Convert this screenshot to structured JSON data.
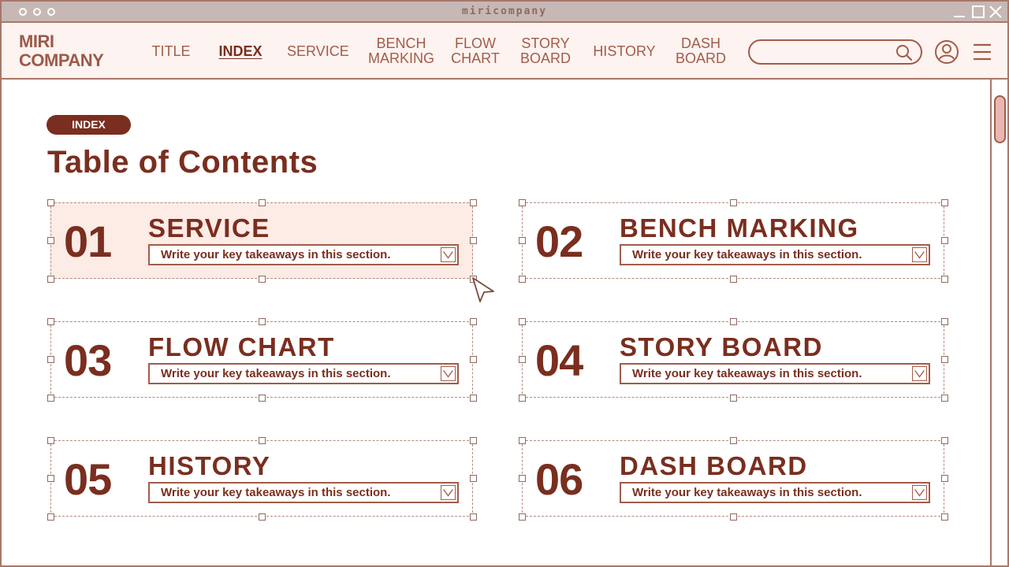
{
  "window": {
    "title": "miricompany"
  },
  "logo": {
    "line1": "MIRI",
    "line2": "COMPANY"
  },
  "nav": {
    "items": [
      {
        "line1": "TITLE",
        "line2": ""
      },
      {
        "line1": "INDEX",
        "line2": ""
      },
      {
        "line1": "SERVICE",
        "line2": ""
      },
      {
        "line1": "BENCH",
        "line2": "MARKING"
      },
      {
        "line1": "FLOW",
        "line2": "CHART"
      },
      {
        "line1": "STORY",
        "line2": "BOARD"
      },
      {
        "line1": "HISTORY",
        "line2": ""
      },
      {
        "line1": "DASH",
        "line2": "BOARD"
      }
    ],
    "active": "INDEX"
  },
  "search": {
    "value": "",
    "placeholder": ""
  },
  "icons": {
    "search": "search-icon",
    "user": "user-icon",
    "menu": "hamburger-menu-icon",
    "dropdown": "chevron-down-icon"
  },
  "content": {
    "badge": "INDEX",
    "title": "Table of Contents",
    "cards": [
      {
        "num": "01",
        "title": "SERVICE",
        "field": "Write your key takeaways in this section."
      },
      {
        "num": "02",
        "title": "BENCH MARKING",
        "field": "Write your key takeaways in this section."
      },
      {
        "num": "03",
        "title": "FLOW CHART",
        "field": "Write your key takeaways in this section."
      },
      {
        "num": "04",
        "title": "STORY BOARD",
        "field": "Write your key takeaways in this section."
      },
      {
        "num": "05",
        "title": "HISTORY",
        "field": "Write your key takeaways in this section."
      },
      {
        "num": "06",
        "title": "DASH BOARD",
        "field": "Write your key takeaways in this section."
      }
    ]
  },
  "colors": {
    "accent": "#7a2e1f",
    "nav_background": "#fdf3f0",
    "titlebar": "#c7b8b5",
    "selected_card": "#fdebe6",
    "scroll_thumb": "#e9b7b2"
  }
}
